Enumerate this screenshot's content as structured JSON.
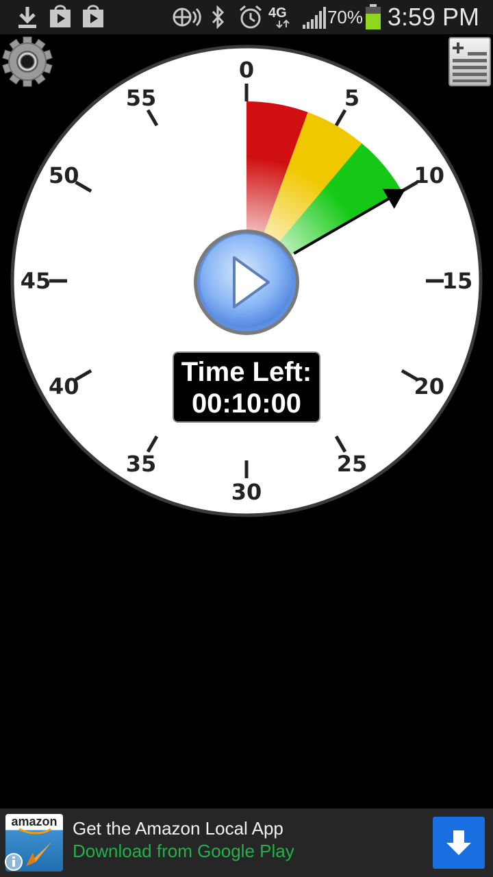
{
  "status_bar": {
    "notification_icons": [
      "download-icon",
      "play-store-icon",
      "play-store-icon"
    ],
    "system_icons": [
      "wifi-signal-icon",
      "bluetooth-icon",
      "alarm-icon",
      "4g-lte-icon",
      "cell-signal-icon",
      "battery-icon"
    ],
    "network_label": "4G",
    "battery_percent": "70%",
    "time": "3:59 PM"
  },
  "toolbar": {
    "settings_icon": "gear-icon",
    "list_add_icon": "list-add-icon"
  },
  "dial": {
    "labels": [
      "0",
      "5",
      "10",
      "15",
      "20",
      "25",
      "30",
      "35",
      "40",
      "45",
      "50",
      "55"
    ],
    "segment_colors": [
      "#d01010",
      "#f0c800",
      "#16c816"
    ],
    "hand_color": "#000000",
    "set_minutes": 10
  },
  "play_button": {
    "icon": "play-icon"
  },
  "timer": {
    "title": "Time Left:",
    "value": "00:10:00"
  },
  "ad": {
    "logo_text": "amazon",
    "title": "Get the Amazon Local App",
    "subtitle": "Download from Google Play",
    "download_icon": "download-arrow-icon",
    "info_icon": "info-icon"
  }
}
